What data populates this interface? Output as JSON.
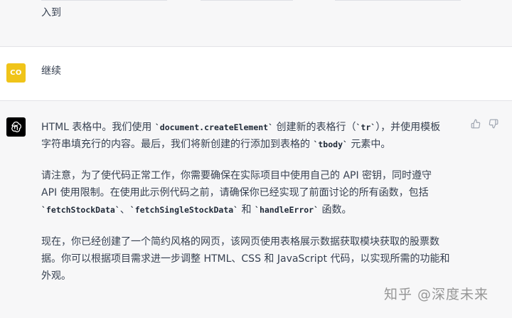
{
  "top_message": {
    "last_line": "入到"
  },
  "user_message": {
    "avatar_initials": "CO",
    "text": "继续"
  },
  "assistant_message": {
    "p1": {
      "a": "HTML 表格中。我们使用 ",
      "code1": "`document.createElement`",
      "b": " 创建新的表格行（",
      "code2": "`tr`",
      "c": "），并使用模板",
      "d": "字符串填充行的内容。最后，我们将新创建的行添加到表格的 ",
      "code3": "`tbody`",
      "e": " 元素中。"
    },
    "p2": {
      "a": "请注意，为了使代码正常工作，你需要确保在实际项目中使用自己的 API 密钥，同时遵守",
      "b": "API 使用限制。在使用此示例代码之前，请确保你已经实现了前面讨论的所有函数，包括",
      "code1": "`fetchStockData`",
      "sep": "、",
      "code2": "`fetchSingleStockData`",
      "and": " 和 ",
      "code3": "`handleError`",
      "end": " 函数。"
    },
    "p3": {
      "a": "现在，你已经创建了一个简约风格的网页，该网页使用表格展示数据获取模块获取的股票数",
      "b": "据。你可以根据项目需求进一步调整 HTML、CSS 和 JavaScript 代码，以实现所需的功能和",
      "c": "外观。"
    }
  },
  "watermark": "知乎 @深度未来",
  "colors": {
    "user_avatar": "#f0c419",
    "ai_avatar": "#000000"
  },
  "icons": [
    "openai-logo-icon",
    "thumbs-up-icon",
    "thumbs-down-icon"
  ]
}
